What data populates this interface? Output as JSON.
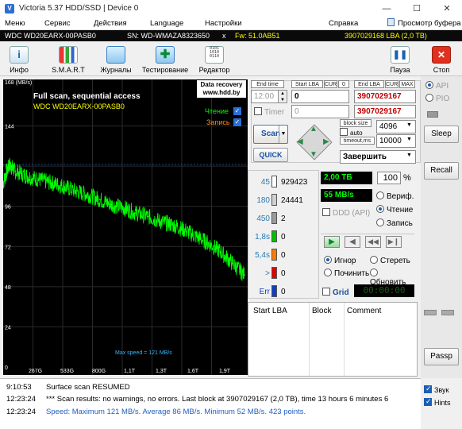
{
  "window": {
    "title": "Victoria 5.37 HDD/SSD | Device 0",
    "min": "—",
    "max": "☐",
    "close": "✕"
  },
  "menu": {
    "items": [
      "Меню",
      "Сервис",
      "Действия",
      "Language",
      "Настройки",
      "Справка"
    ],
    "clipboard": "Просмотр буфера"
  },
  "drive": {
    "model": "WDC WD20EARX-00PASB0",
    "serial": "SN: WD-WMAZA8323650",
    "x": "x",
    "fw": "Fw: 51.0AB51",
    "lba": "3907029168 LBA (2,0 TB)"
  },
  "toolbar": {
    "info": "Инфо",
    "smart": "S.M.A.R.T",
    "logs": "Журналы",
    "test": "Тестирование",
    "editor": "Редактор",
    "pause": "Пауза",
    "stop": "Стоп"
  },
  "graph": {
    "y_top": "168 (MB/s)",
    "y_labels": [
      "144",
      "120",
      "96",
      "72",
      "48",
      "24",
      "0"
    ],
    "x_labels": [
      "267G",
      "533G",
      "800G",
      "1,1T",
      "1,3T",
      "1,6T",
      "1,9T"
    ],
    "title": "Full scan, sequential access",
    "model": "WDC WD20EARX-00PASB0",
    "badge1": "Data recovery",
    "badge2": "www.hdd.by",
    "read": "Чтение",
    "write": "Запись",
    "max_speed": "Max speed = 121 MB/s",
    "colors": {
      "read": "#00ff00",
      "write": "#ff7000",
      "title": "#ffffff",
      "model": "#ffff00"
    }
  },
  "chart_data": {
    "type": "line",
    "title": "Full scan, sequential access",
    "ylabel": "(MB/s)",
    "ylim": [
      0,
      168
    ],
    "x_ticks": [
      "267G",
      "533G",
      "800G",
      "1,1T",
      "1,3T",
      "1,6T",
      "1,9T"
    ],
    "series": [
      {
        "name": "Чтение",
        "x_tb": [
          0.0,
          0.05,
          0.1,
          0.2,
          0.3,
          0.4,
          0.5,
          0.6,
          0.7,
          0.8,
          0.9,
          1.0,
          1.1,
          1.2,
          1.3,
          1.4,
          1.5,
          1.6,
          1.7,
          1.8,
          1.9,
          2.0
        ],
        "values": [
          110,
          121,
          117,
          114,
          112,
          110,
          108,
          105,
          103,
          100,
          97,
          95,
          92,
          90,
          87,
          85,
          82,
          78,
          74,
          69,
          62,
          55
        ]
      }
    ]
  },
  "controls": {
    "end_time_lbl": "End time",
    "end_time": "12:00",
    "start_lba_lbl": "Start LBA",
    "cur": "CUR",
    "zero": "0",
    "end_lba_lbl": "End LBA",
    "max": "MAX",
    "timer_lbl": "Timer",
    "start_lba": "0",
    "end_lba": "3907029167",
    "timer_val": "0",
    "timer_lba": "3907029167",
    "scan": "Scan",
    "quick": "QUICK",
    "block_size_lbl": "block size",
    "auto": "auto",
    "block_size": "4096",
    "timeout_lbl": "timeout,ms",
    "timeout": "10000",
    "finish": "Завершить"
  },
  "blocks": [
    {
      "label": "45",
      "count": "929423",
      "color": "#ffffff"
    },
    {
      "label": "180",
      "count": "24441",
      "color": "#d0d0d0"
    },
    {
      "label": "450",
      "count": "2",
      "color": "#9a9a9a"
    },
    {
      "label": "1,8s",
      "count": "0",
      "color": "#00c000"
    },
    {
      "label": "5,4s",
      "count": "0",
      "color": "#ff7a00"
    },
    {
      "label": ">",
      "count": "0",
      "color": "#e00000"
    },
    {
      "label": "Err",
      "count": "0",
      "color": "#1040c0"
    }
  ],
  "status": {
    "size": "2,00 ТБ",
    "percent": "100",
    "percent_sign": "%",
    "speed": "55 MB/s",
    "verify": "Вериф.",
    "read": "Чтение",
    "write": "Запись",
    "ddd": "DDD (API)",
    "ignore": "Игнор",
    "erase": "Стереть",
    "remap": "Починить",
    "refresh": "Обновить",
    "grid": "Grid",
    "clock": "00:00:00"
  },
  "table": {
    "col1": "Start LBA",
    "col2": "Block",
    "col3": "Comment"
  },
  "side": {
    "api": "API",
    "pio": "PIO",
    "sleep": "Sleep",
    "recall": "Recall",
    "passp": "Passp",
    "sound": "Звук",
    "hints": "Hints"
  },
  "log": [
    {
      "time": "9:10:53",
      "msg": "Surface scan RESUMED",
      "color": "#000000"
    },
    {
      "time": "12:23:24",
      "msg": "*** Scan results: no warnings, no errors. Last block at 3907029167 (2,0 TB), time 13 hours 6 minutes 6",
      "color": "#000000"
    },
    {
      "time": "12:23:24",
      "msg": "Speed: Maximum 121 MB/s. Average 86 MB/s. Minimum 52 MB/s. 423 points.",
      "color": "#1f5fbf"
    }
  ]
}
